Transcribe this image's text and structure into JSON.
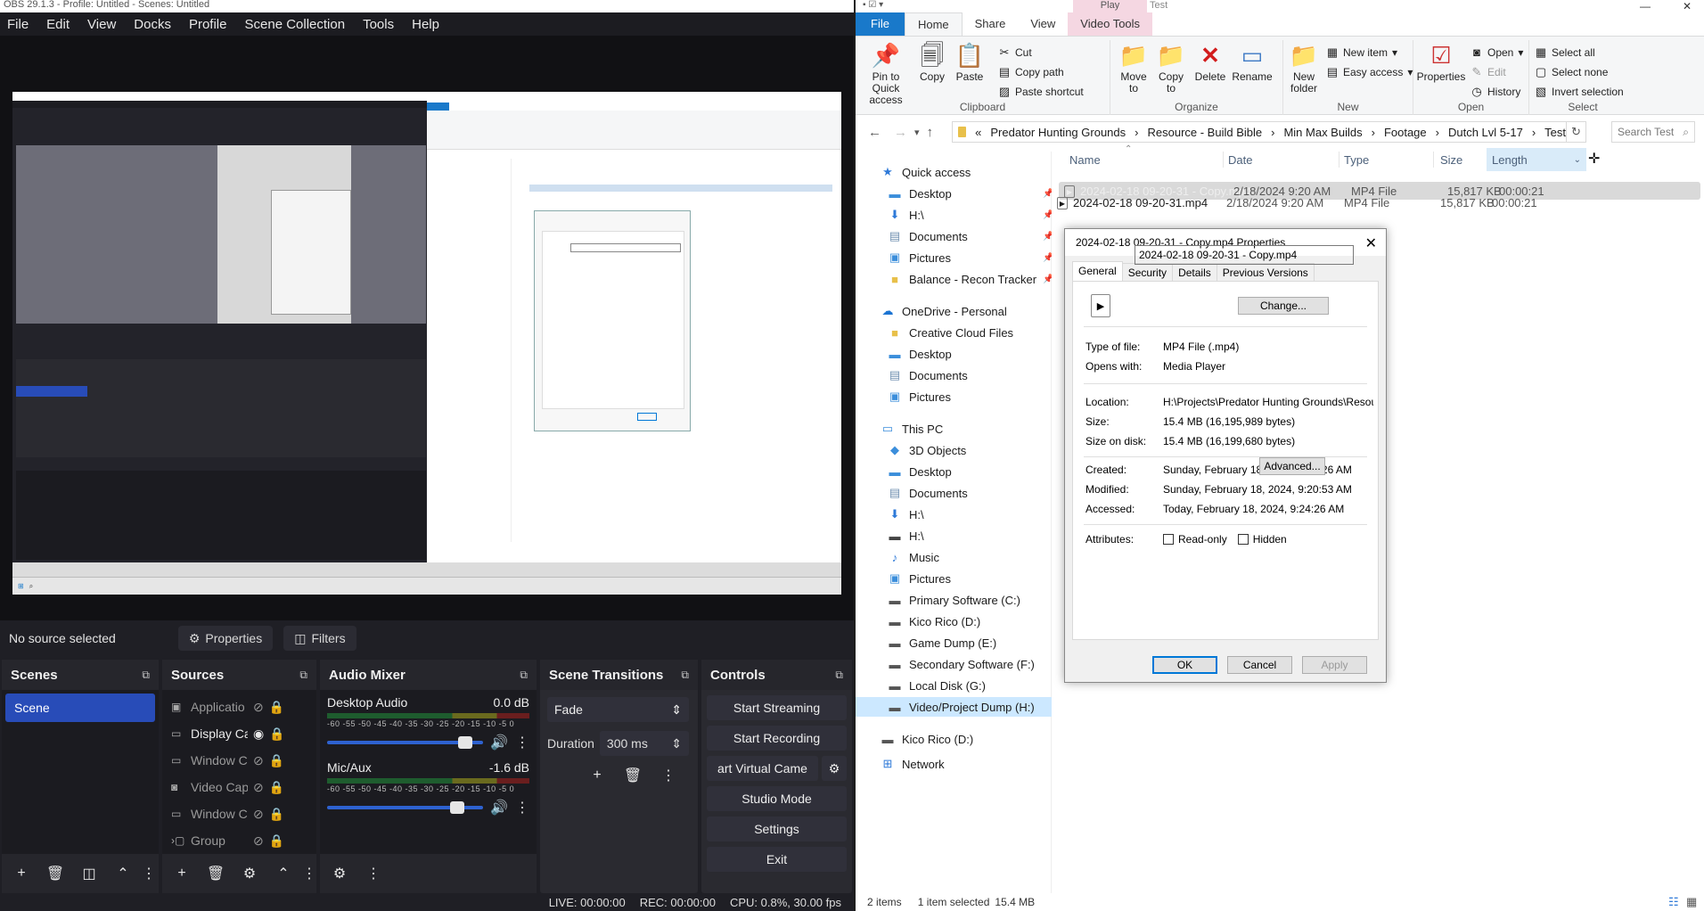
{
  "obs": {
    "title": "OBS 29.1.3 - Profile: Untitled - Scenes: Untitled",
    "menu": [
      "File",
      "Edit",
      "View",
      "Docks",
      "Profile",
      "Scene Collection",
      "Tools",
      "Help"
    ],
    "source_toolbar": {
      "status": "No source selected",
      "properties": "Properties",
      "filters": "Filters"
    },
    "scenes": {
      "title": "Scenes",
      "items": [
        "Scene"
      ]
    },
    "sources": {
      "title": "Sources",
      "items": [
        {
          "name": "Applicatio",
          "icon": "application-icon",
          "visible": false
        },
        {
          "name": "Display Ca",
          "icon": "display-icon",
          "visible": true
        },
        {
          "name": "Window C",
          "icon": "window-icon",
          "visible": false
        },
        {
          "name": "Video Cap",
          "icon": "camera-icon",
          "visible": false
        },
        {
          "name": "Window C",
          "icon": "window-icon",
          "visible": false
        },
        {
          "name": "Group",
          "icon": "folder-icon",
          "visible": false
        }
      ]
    },
    "mixer": {
      "title": "Audio Mixer",
      "ticks": "-60 -55 -50 -45 -40 -35 -30 -25 -20 -15 -10 -5 0",
      "channels": [
        {
          "name": "Desktop Audio",
          "db": "0.0 dB",
          "level": 0.93
        },
        {
          "name": "Mic/Aux",
          "db": "-1.6 dB",
          "level": 0.88
        }
      ]
    },
    "transitions": {
      "title": "Scene Transitions",
      "selected": "Fade",
      "duration_label": "Duration",
      "duration_value": "300 ms"
    },
    "controls": {
      "title": "Controls",
      "start_streaming": "Start Streaming",
      "start_recording": "Start Recording",
      "virtual_camera": "art Virtual Came",
      "studio_mode": "Studio Mode",
      "settings": "Settings",
      "exit": "Exit"
    },
    "status": {
      "live": "LIVE: 00:00:00",
      "rec": "REC: 00:00:00",
      "cpu": "CPU: 0.8%, 30.00 fps"
    }
  },
  "explorer": {
    "contextual_tab_header": "Play",
    "window_title": "Test",
    "tabs": [
      "File",
      "Home",
      "Share",
      "View",
      "Video Tools"
    ],
    "ribbon": {
      "clipboard": {
        "label": "Clipboard",
        "pin": "Pin to Quick access",
        "copy": "Copy",
        "paste": "Paste",
        "cut": "Cut",
        "copy_path": "Copy path",
        "paste_shortcut": "Paste shortcut"
      },
      "organize": {
        "label": "Organize",
        "move_to": "Move to",
        "copy_to": "Copy to",
        "delete": "Delete",
        "rename": "Rename"
      },
      "new": {
        "label": "New",
        "new_folder": "New folder",
        "new_item": "New item",
        "easy_access": "Easy access"
      },
      "open": {
        "label": "Open",
        "properties": "Properties",
        "open": "Open",
        "edit": "Edit",
        "history": "History"
      },
      "select": {
        "label": "Select",
        "select_all": "Select all",
        "select_none": "Select none",
        "invert": "Invert selection"
      }
    },
    "address": {
      "prefix": "«",
      "crumbs": [
        "Predator Hunting Grounds",
        "Resource - Build Bible",
        "Min Max Builds",
        "Footage",
        "Dutch Lvl 5-17",
        "Test"
      ],
      "search_placeholder": "Search Test"
    },
    "nav": {
      "quick_access": "Quick access",
      "quick_items": [
        "Desktop",
        "H:\\",
        "Documents",
        "Pictures",
        "Balance - Recon Tracker"
      ],
      "onedrive": "OneDrive - Personal",
      "onedrive_items": [
        "Creative Cloud Files",
        "Desktop",
        "Documents",
        "Pictures"
      ],
      "this_pc": "This PC",
      "pc_items": [
        "3D Objects",
        "Desktop",
        "Documents",
        "H:\\",
        "H:\\",
        "Music",
        "Pictures",
        "Primary Software (C:)",
        "Kico Rico (D:)",
        "Game Dump (E:)",
        "Secondary Software (F:)",
        "Local Disk (G:)",
        "Video/Project Dump (H:)"
      ],
      "kico": "Kico Rico (D:)",
      "network": "Network"
    },
    "columns": [
      "Name",
      "Date",
      "Type",
      "Size",
      "Length"
    ],
    "files": [
      {
        "name": "2024-02-18 09-20-31 - Copy.mp4",
        "date": "2/18/2024 9:20 AM",
        "type": "MP4 File",
        "size": "15,817 KB",
        "length": "00:00:21",
        "selected": true
      },
      {
        "name": "2024-02-18 09-20-31.mp4",
        "date": "2/18/2024 9:20 AM",
        "type": "MP4 File",
        "size": "15,817 KB",
        "length": "00:00:21",
        "selected": false
      }
    ],
    "status": {
      "items": "2 items",
      "selected": "1 item selected",
      "size": "15.4 MB"
    }
  },
  "properties": {
    "title": "2024-02-18 09-20-31 - Copy.mp4 Properties",
    "tabs": [
      "General",
      "Security",
      "Details",
      "Previous Versions"
    ],
    "filename": "2024-02-18 09-20-31 - Copy.mp4",
    "type_label": "Type of file:",
    "type_value": "MP4 File (.mp4)",
    "opens_label": "Opens with:",
    "opens_value": "Media Player",
    "change": "Change...",
    "location_label": "Location:",
    "location_value": "H:\\Projects\\Predator Hunting Grounds\\Resource - B",
    "size_label": "Size:",
    "size_value": "15.4 MB (16,195,989 bytes)",
    "disk_label": "Size on disk:",
    "disk_value": "15.4 MB (16,199,680 bytes)",
    "created_label": "Created:",
    "created_value": "Sunday, February 18, 2024, 9:24:26 AM",
    "modified_label": "Modified:",
    "modified_value": "Sunday, February 18, 2024, 9:20:53 AM",
    "accessed_label": "Accessed:",
    "accessed_value": "Today, February 18, 2024, 9:24:26 AM",
    "attributes_label": "Attributes:",
    "readonly": "Read-only",
    "hidden": "Hidden",
    "advanced": "Advanced...",
    "ok": "OK",
    "cancel": "Cancel",
    "apply": "Apply"
  }
}
